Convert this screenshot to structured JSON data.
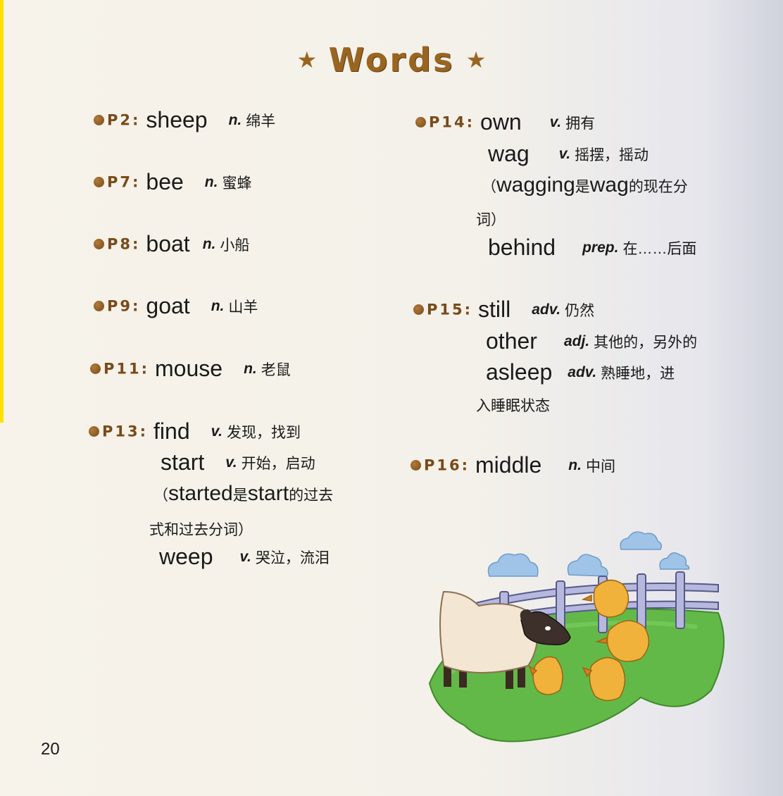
{
  "title": "Words",
  "icons": {
    "title_star": "star-icon",
    "bullet": "dot-bullet-icon"
  },
  "colors": {
    "title": "#9a6520",
    "bullet": "#8a5a24"
  },
  "entries": [
    {
      "page": "P2:",
      "word": "sheep",
      "pos": "n.",
      "meaning": "绵羊"
    },
    {
      "page": "P7:",
      "word": "bee",
      "pos": "n.",
      "meaning": "蜜蜂"
    },
    {
      "page": "P8:",
      "word": "boat",
      "pos": "n.",
      "meaning": "小船"
    },
    {
      "page": "P9:",
      "word": "goat",
      "pos": "n.",
      "meaning": "山羊"
    },
    {
      "page": "P11:",
      "word": "mouse",
      "pos": "n.",
      "meaning": "老鼠"
    },
    {
      "page": "P13:",
      "word": "find",
      "pos": "v.",
      "meaning": "发现，找到"
    },
    {
      "word": "start",
      "pos": "v.",
      "meaning": "开始，启动"
    },
    {
      "note_open": "（",
      "note_word1": "started",
      "note_mid": "是",
      "note_word2": "start",
      "note_end": "的过去",
      "note_line2": "式和过去分词）"
    },
    {
      "word": "weep",
      "pos": "v.",
      "meaning": "哭泣，流泪"
    },
    {
      "page": "P14:",
      "word": "own",
      "pos": "v.",
      "meaning": "拥有"
    },
    {
      "word": "wag",
      "pos": "v.",
      "meaning": "摇摆，摇动"
    },
    {
      "note_open": "（",
      "note_word1": "wagging",
      "note_mid": "是",
      "note_word2": "wag",
      "note_end": "的现在分",
      "note_line2": "词）"
    },
    {
      "word": "behind",
      "pos": "prep.",
      "meaning": "在……后面"
    },
    {
      "page": "P15:",
      "word": "still",
      "pos": "adv.",
      "meaning": "仍然"
    },
    {
      "word": "other",
      "pos": "adj.",
      "meaning": "其他的，另外的"
    },
    {
      "word": "asleep",
      "pos": "adv.",
      "meaning": "熟睡地，进",
      "meaning_line2": "入睡眠状态"
    },
    {
      "page": "P16:",
      "word": "middle",
      "pos": "n.",
      "meaning": "中间"
    }
  ],
  "page_number": "20"
}
